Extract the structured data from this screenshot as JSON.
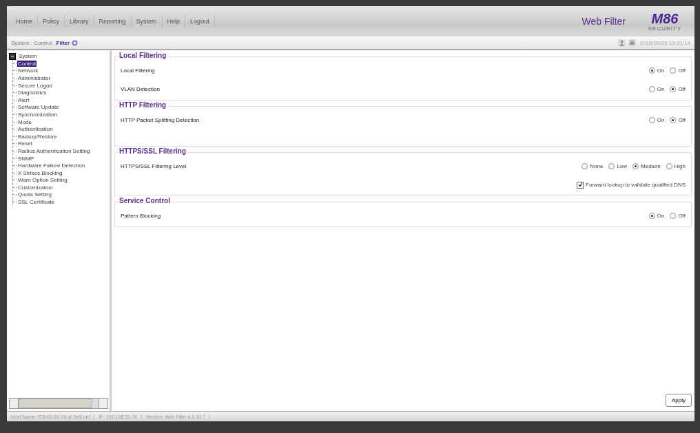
{
  "menu": [
    "Home",
    "Policy",
    "Library",
    "Reporting",
    "System",
    "Help",
    "Logout"
  ],
  "product": "Web Filter",
  "logo": {
    "mark": "M86",
    "sub": "SECURITY"
  },
  "breadcrumb": {
    "path": "System : Control : ",
    "current": "Filter"
  },
  "timestamp": "2010/06/25 13:31:14",
  "tree": {
    "label": "System",
    "expanded": true,
    "children": [
      {
        "label": "Control",
        "selected": true
      },
      {
        "label": "Network",
        "selected": false
      },
      {
        "label": "Administrator",
        "selected": false
      },
      {
        "label": "Secure Logon",
        "selected": false
      },
      {
        "label": "Diagnostics",
        "selected": false
      },
      {
        "label": "Alert",
        "selected": false
      },
      {
        "label": "Software Update",
        "selected": false
      },
      {
        "label": "Synchronization",
        "selected": false
      },
      {
        "label": "Mode",
        "selected": false
      },
      {
        "label": "Authentication",
        "selected": false
      },
      {
        "label": "Backup/Restore",
        "selected": false
      },
      {
        "label": "Reset",
        "selected": false
      },
      {
        "label": "Radius Authentication Setting",
        "selected": false
      },
      {
        "label": "SNMP",
        "selected": false
      },
      {
        "label": "Hardware Failure Detection",
        "selected": false
      },
      {
        "label": "X Strikes Blocking",
        "selected": false
      },
      {
        "label": "Warn Option Setting",
        "selected": false
      },
      {
        "label": "Customization",
        "selected": false
      },
      {
        "label": "Quota Setting",
        "selected": false
      },
      {
        "label": "SSL Certificate",
        "selected": false
      }
    ]
  },
  "sections": [
    {
      "title": "Local Filtering",
      "rows": [
        {
          "kind": "radio",
          "label": "Local Filtering",
          "options": [
            {
              "label": "On",
              "selected": true
            },
            {
              "label": "Off",
              "selected": false
            }
          ]
        },
        {
          "kind": "radio",
          "label": "VLAN Detection",
          "options": [
            {
              "label": "On",
              "selected": false
            },
            {
              "label": "Off",
              "selected": true
            }
          ]
        }
      ]
    },
    {
      "title": "HTTP Filtering",
      "rows": [
        {
          "kind": "radio",
          "label": "HTTP Packet Splitting Detection",
          "options": [
            {
              "label": "On",
              "selected": false
            },
            {
              "label": "Off",
              "selected": true
            }
          ]
        },
        {
          "kind": "spacer"
        }
      ]
    },
    {
      "title": "HTTPS/SSL Filtering",
      "rows": [
        {
          "kind": "radio",
          "label": "HTTPS/SSL Filtering Level",
          "options": [
            {
              "label": "None",
              "selected": false
            },
            {
              "label": "Low",
              "selected": false
            },
            {
              "label": "Medium",
              "selected": true
            },
            {
              "label": "High",
              "selected": false
            }
          ]
        },
        {
          "kind": "checkbox",
          "label": "Forward lookup to validate qualified DNS",
          "checked": true
        }
      ]
    },
    {
      "title": "Service Control",
      "rows": [
        {
          "kind": "radio",
          "label": "Pattern Blocking",
          "options": [
            {
              "label": "On",
              "selected": true
            },
            {
              "label": "Off",
              "selected": false
            }
          ]
        }
      ]
    }
  ],
  "apply": "Apply",
  "status_bar": [
    "Host Name: R3000-20-74.qc.8e6.net",
    "IP: 192.168.20.74",
    "Version: Web Filter 4.0.10.7"
  ]
}
